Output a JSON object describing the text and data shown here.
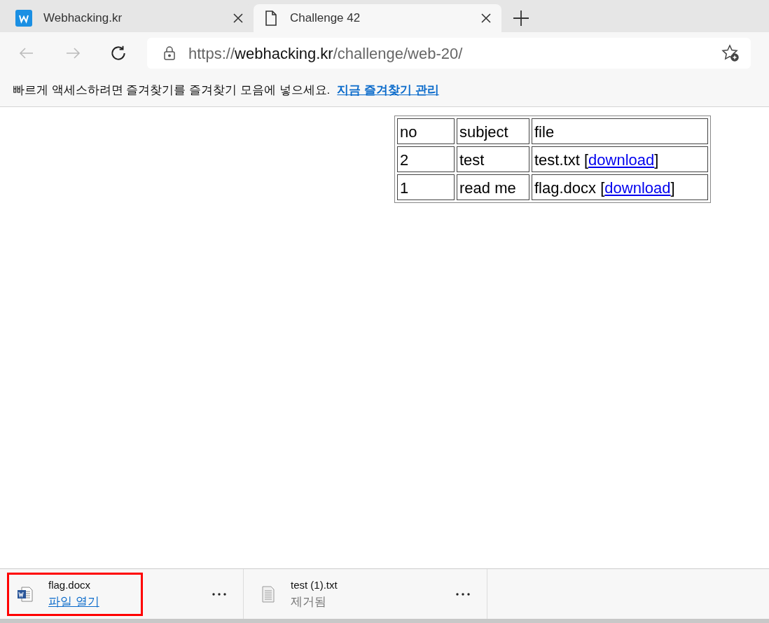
{
  "tabs": [
    {
      "title": "Webhacking.kr",
      "kind": "site",
      "selected": false
    },
    {
      "title": "Challenge 42",
      "kind": "page",
      "selected": true
    }
  ],
  "address_bar": {
    "scheme": "https://",
    "host": "webhacking.kr",
    "path": "/challenge/web-20/"
  },
  "favorites_bar": {
    "message": "빠르게 액세스하려면 즐겨찾기를 즐겨찾기 모음에 넣으세요.",
    "link": "지금 즐겨찾기 관리"
  },
  "table": {
    "columns": [
      "no",
      "subject",
      "file"
    ],
    "rows": [
      {
        "no": "2",
        "subject": "test",
        "file": {
          "name": "test.txt",
          "open": "[",
          "link": "download",
          "close": "]"
        }
      },
      {
        "no": "1",
        "subject": "read me",
        "file": {
          "name": "flag.docx",
          "open": "[",
          "link": "download",
          "close": "]"
        }
      }
    ]
  },
  "downloads": [
    {
      "name": "flag.docx",
      "status": "파일 열기",
      "kind": "word",
      "status_is_link": true,
      "selected": true
    },
    {
      "name": "test (1).txt",
      "status": "제거됨",
      "kind": "text",
      "status_is_link": false,
      "selected": false
    }
  ]
}
